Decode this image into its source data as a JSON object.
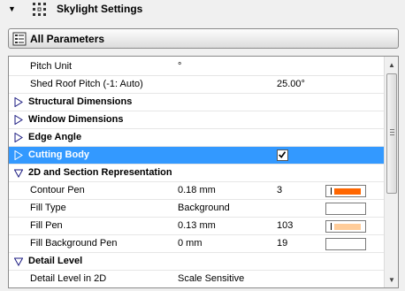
{
  "header": {
    "title": "Skylight Settings",
    "collapse_icon": "triangle-down-icon",
    "settings_icon": "grid-settings-icon"
  },
  "toolbar": {
    "all_parameters_label": "All Parameters",
    "all_parameters_icon": "parameter-list-icon"
  },
  "params": {
    "pitch_unit": {
      "name": "Pitch Unit",
      "value": "°"
    },
    "shed_roof_pitch": {
      "name": "Shed Roof Pitch (-1: Auto)",
      "value": "25.00°"
    },
    "structural_dimensions": {
      "name": "Structural Dimensions",
      "state": "collapsed"
    },
    "window_dimensions": {
      "name": "Window Dimensions",
      "state": "collapsed"
    },
    "edge_angle": {
      "name": "Edge Angle",
      "state": "collapsed"
    },
    "cutting_body": {
      "name": "Cutting Body",
      "state": "collapsed",
      "checked": true,
      "selected": true
    },
    "section_2d": {
      "name": "2D and Section Representation",
      "state": "expanded"
    },
    "contour_pen": {
      "name": "Contour Pen",
      "value": "0.18 mm",
      "pen": "3",
      "color": "#ff6600"
    },
    "fill_type": {
      "name": "Fill Type",
      "value": "Background"
    },
    "fill_pen": {
      "name": "Fill Pen",
      "value": "0.13 mm",
      "pen": "103",
      "color": "#ffcc99"
    },
    "fill_background_pen": {
      "name": "Fill Background Pen",
      "value": "0 mm",
      "pen": "19"
    },
    "detail_level": {
      "name": "Detail Level",
      "state": "expanded"
    },
    "detail_level_2d": {
      "name": "Detail Level in 2D",
      "value": "Scale Sensitive"
    }
  },
  "colors": {
    "selection": "#3399ff",
    "section_triangle": "#1a1a80"
  }
}
